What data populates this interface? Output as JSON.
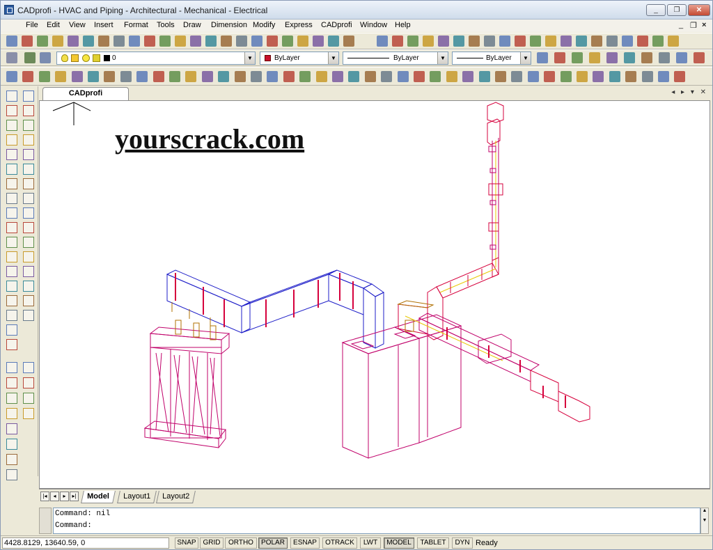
{
  "window": {
    "title": "CADprofi - HVAC and Piping - Architectural - Mechanical - Electrical",
    "controls": [
      "_",
      "❐",
      "✕"
    ]
  },
  "menu": {
    "items": [
      "File",
      "Edit",
      "View",
      "Insert",
      "Format",
      "Tools",
      "Draw",
      "Dimension",
      "Modify",
      "Express",
      "CADprofi",
      "Window",
      "Help"
    ],
    "mdi_controls": [
      "_",
      "❐",
      "×"
    ]
  },
  "properties": {
    "layer_value": "0",
    "color_value": "ByLayer",
    "linetype_value": "ByLayer",
    "lineweight_value": "ByLayer",
    "color_swatch": "#c8102e"
  },
  "document": {
    "tab_label": "CADprofi",
    "tab_controls": "◂ ▸ ▾ ✕"
  },
  "watermark": "yourscrack.com",
  "layouts": {
    "tabs": [
      "Model",
      "Layout1",
      "Layout2"
    ],
    "active": "Model",
    "nav": [
      "|◂",
      "◂",
      "▸",
      "▸|"
    ]
  },
  "command": {
    "lines": [
      "Command: nil",
      "Command:"
    ]
  },
  "status": {
    "coordinates": "4428.8129,  13640.59,  0",
    "buttons": [
      {
        "label": "SNAP",
        "on": false
      },
      {
        "label": "GRID",
        "on": false
      },
      {
        "label": "ORTHO",
        "on": false
      },
      {
        "label": "POLAR",
        "on": true
      },
      {
        "label": "ESNAP",
        "on": false
      },
      {
        "label": "OTRACK",
        "on": false
      },
      {
        "label": "LWT",
        "on": false
      },
      {
        "label": "MODEL",
        "on": true
      },
      {
        "label": "TABLET",
        "on": false
      },
      {
        "label": "DYN",
        "on": false
      }
    ],
    "message": "Ready"
  },
  "colors": {
    "duct_red": "#d6003c",
    "duct_blue": "#1e1ec8",
    "duct_yellow": "#e8c800",
    "pipe_magenta": "#c0006a"
  },
  "icons": {
    "toolbar1": [
      "new-icon",
      "open-icon",
      "save-icon",
      "plot-icon",
      "preview-icon",
      "publish-icon",
      "cut-icon",
      "copy-icon",
      "paste-icon",
      "matchprop-icon",
      "undo-icon",
      "redo-icon",
      "pan-icon",
      "zoom-realtime-icon",
      "zoom-window-icon",
      "zoom-previous-icon",
      "properties-icon",
      "designcenter-icon",
      "toolpalette-icon",
      "sheetset-icon",
      "markup-icon",
      "calc-icon",
      "help-icon"
    ],
    "left1": [
      "line-icon",
      "xline-icon",
      "polyline-icon",
      "polygon-icon",
      "rectangle-icon",
      "arc-icon",
      "circle-icon",
      "revcloud-icon",
      "spline-icon",
      "ellipse-icon",
      "ellipse-arc-icon",
      "insert-block-icon",
      "make-block-icon",
      "point-icon",
      "hatch-icon",
      "region-icon",
      "table-icon",
      "mtext-icon"
    ],
    "left2": [
      "erase-icon",
      "copy-obj-icon",
      "mirror-icon",
      "offset-icon",
      "array-icon",
      "move-icon",
      "rotate-icon",
      "scale-icon",
      "stretch-icon",
      "trim-icon",
      "extend-icon",
      "break-icon",
      "join-icon",
      "chamfer-icon",
      "fillet-icon",
      "explode-icon"
    ]
  }
}
